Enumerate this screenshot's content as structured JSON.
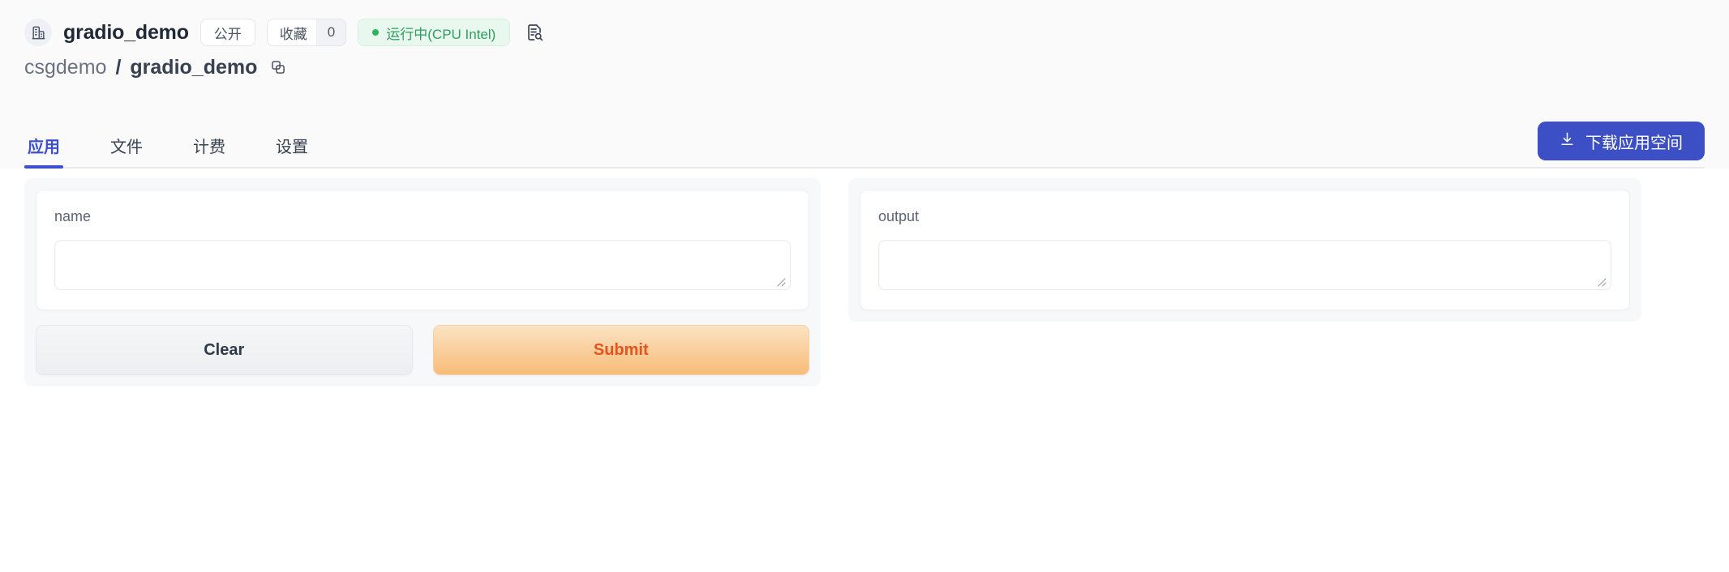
{
  "header": {
    "avatar_icon": "organization-building-icon",
    "repo_name": "gradio_demo",
    "visibility_label": "公开",
    "favorite_label": "收藏",
    "favorite_count": "0",
    "status_text": "运行中(CPU Intel)",
    "status_color": "#2eb35f",
    "log_icon": "document-search-icon"
  },
  "breadcrumb": {
    "owner": "csgdemo",
    "separator": "/",
    "repo": "gradio_demo",
    "copy_icon": "copy-icon"
  },
  "tabs": {
    "items": [
      {
        "label": "应用",
        "active": true
      },
      {
        "label": "文件",
        "active": false
      },
      {
        "label": "计费",
        "active": false
      },
      {
        "label": "设置",
        "active": false
      }
    ],
    "active_color": "#3b4fd0",
    "download_button": {
      "label": "下载应用空间",
      "icon": "download-icon",
      "bg_color": "#3c4fc4"
    }
  },
  "app": {
    "input": {
      "label": "name",
      "value": "",
      "placeholder": ""
    },
    "output": {
      "label": "output",
      "value": "",
      "placeholder": ""
    },
    "buttons": {
      "clear_label": "Clear",
      "submit_label": "Submit",
      "submit_text_color": "#e8521c"
    }
  }
}
